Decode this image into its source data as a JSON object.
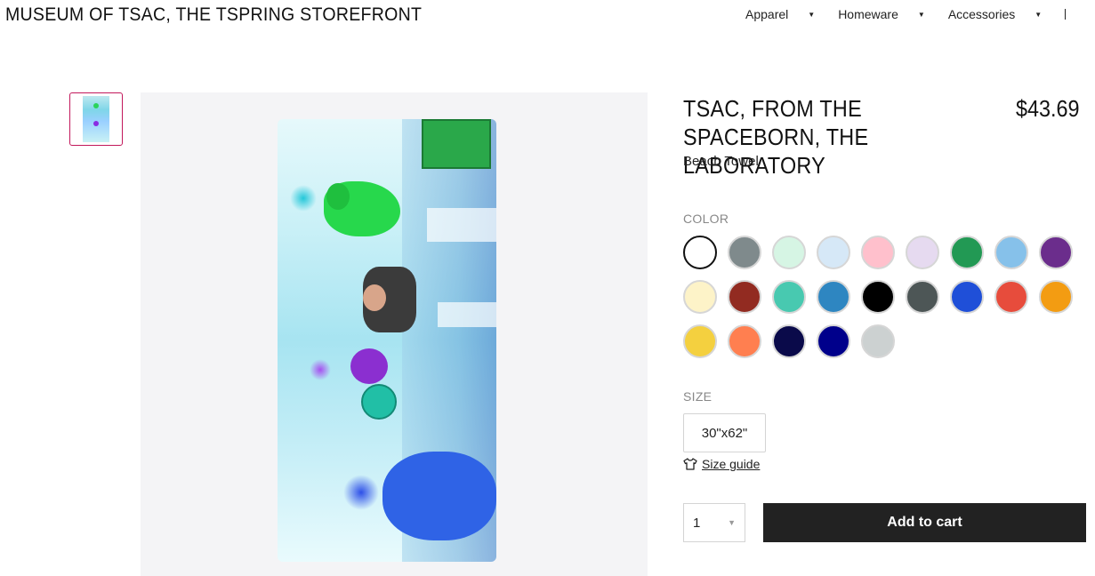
{
  "header": {
    "store_title": "MUSEUM OF TSAC, THE TSPRING STOREFRONT",
    "nav": [
      {
        "label": "Apparel",
        "icon": "caret-down-icon"
      },
      {
        "label": "Homeware",
        "icon": "caret-down-icon"
      },
      {
        "label": "Accessories",
        "icon": "caret-down-icon"
      }
    ]
  },
  "gallery": {
    "thumbnail_count": 1,
    "selected_thumbnail_border": "#c2185b"
  },
  "product": {
    "title": "TSAC, FROM THE SPACEBORN, THE LABORATORY",
    "price": "$43.69",
    "type": "Beach Towel",
    "color_label": "COLOR",
    "colors": [
      "#ffffff",
      "#7f8a8c",
      "#d6f5e4",
      "#d6e8f7",
      "#ffc0cc",
      "#e6daf0",
      "#229954",
      "#86c1ea",
      "#6b2d8c",
      "#fdf3c8",
      "#922b21",
      "#48c9b0",
      "#2e86c1",
      "#000000",
      "#4d5656",
      "#1f4fd8",
      "#e74c3c",
      "#f39c12",
      "#f4d03f",
      "#ff7f50",
      "#0a0a4a",
      "#00008b",
      "#ccd1d1"
    ],
    "selected_color_index": 0,
    "size_label": "SIZE",
    "size_option": "30\"x62\"",
    "size_guide": "Size guide",
    "quantity": "1",
    "add_to_cart": "Add to cart"
  }
}
